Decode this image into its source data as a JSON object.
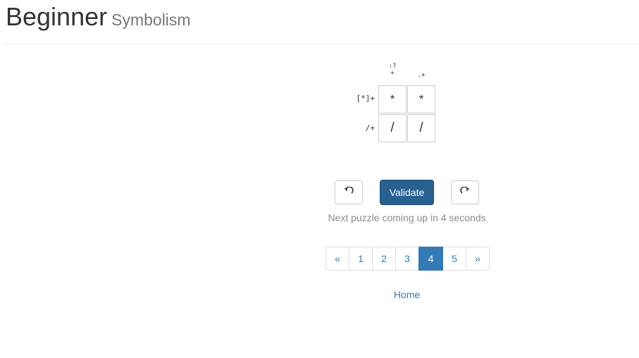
{
  "header": {
    "title": "Beginner",
    "subtitle": "Symbolism"
  },
  "puzzle": {
    "column_clues": [
      ":?+",
      ".+"
    ],
    "row_clues": [
      "[*]+",
      "/+"
    ],
    "cells": [
      [
        "*",
        "*"
      ],
      [
        "/",
        "/"
      ]
    ]
  },
  "controls": {
    "undo_icon": "undo-arrow-icon",
    "validate_label": "Validate",
    "redo_icon": "redo-arrow-icon",
    "message": "Next puzzle coming up in 4 seconds"
  },
  "pagination": {
    "prev": "«",
    "pages": [
      "1",
      "2",
      "3",
      "4",
      "5"
    ],
    "active": "4",
    "next": "»"
  },
  "footer": {
    "home_label": "Home"
  },
  "colors": {
    "primary": "#286090",
    "link": "#337ab7",
    "active_page": "#337ab7"
  }
}
